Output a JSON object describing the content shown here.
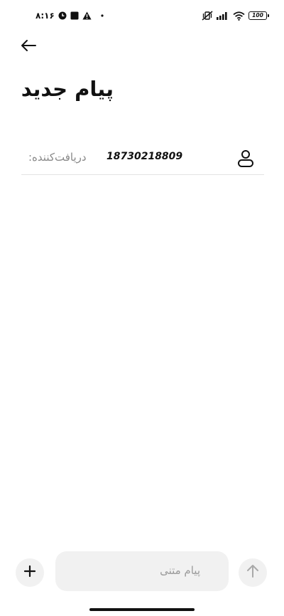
{
  "status_bar": {
    "time": "۸:۱۶",
    "battery_level": "100",
    "left_icons": [
      "clock-circle-icon",
      "square-icon",
      "warning-icon",
      "dot-icon"
    ],
    "right_icons": [
      "vibrate-off-icon",
      "signal-icon",
      "wifi-icon",
      "battery-icon"
    ]
  },
  "header": {
    "back_icon": "arrow-left-icon",
    "title": "پیام جدید"
  },
  "recipient": {
    "label": "دریافت‌کننده:",
    "value": "18730218809",
    "icon": "person-icon"
  },
  "composer": {
    "add_icon": "plus-icon",
    "placeholder": "پیام متنی",
    "send_icon": "arrow-up-icon"
  },
  "colors": {
    "text": "#111111",
    "muted": "#888888",
    "field_bg": "#f1f1f1",
    "divider": "#e3e3e3"
  }
}
